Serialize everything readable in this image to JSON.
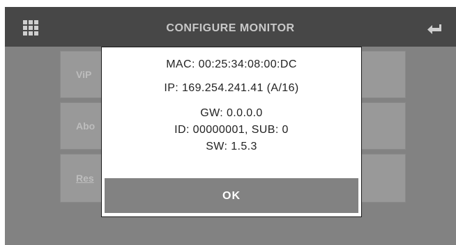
{
  "header": {
    "title": "CONFIGURE MONITOR",
    "menu_icon": "grid-menu-icon",
    "back_icon": "return-arrow-icon"
  },
  "menu": {
    "items": [
      {
        "label": "ViP"
      },
      {
        "label": "Abo"
      },
      {
        "label": "Res"
      }
    ]
  },
  "dialog": {
    "mac": "MAC: 00:25:34:08:00:DC",
    "ip": "IP: 169.254.241.41 (A/16)",
    "gw": "GW: 0.0.0.0",
    "id": "ID: 00000001, SUB: 0",
    "sw": "SW: 1.5.3",
    "ok_label": "OK"
  },
  "colors": {
    "header_bg": "#474747",
    "screen_bg": "#828282",
    "dialog_bg": "#ffffff",
    "ok_bg": "#828282"
  }
}
